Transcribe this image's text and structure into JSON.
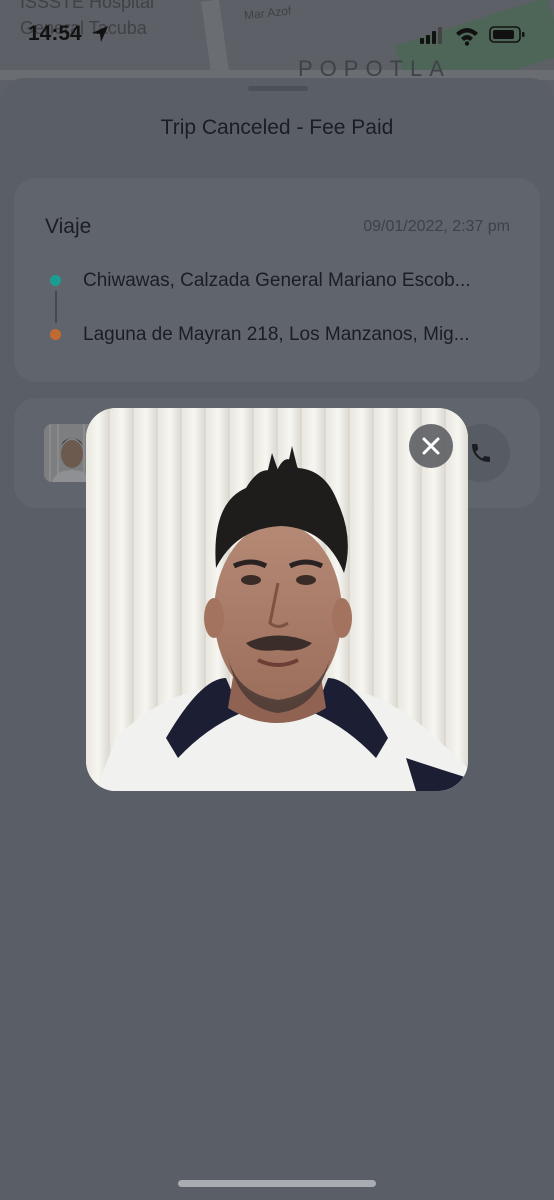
{
  "map": {
    "labels": [
      "ISSSTE Hospital",
      "General Tacuba",
      "Mar Azof",
      "POPOTLA"
    ]
  },
  "status_bar": {
    "time": "14:54",
    "icons": [
      "location-arrow-icon",
      "signal-icon",
      "wifi-icon",
      "battery-icon"
    ]
  },
  "sheet": {
    "title": "Trip Canceled - Fee Paid"
  },
  "trip": {
    "label": "Viaje",
    "datetime": "09/01/2022, 2:37 pm",
    "origin": "Chiwawas, Calzada General Mariano Escob...",
    "destination": "Laguna de Mayran 218, Los Manzanos, Mig...",
    "origin_color": "#1a9e92",
    "destination_color": "#c26a30"
  },
  "driver": {
    "avatar_icon": "driver-photo",
    "call_icon": "phone-icon"
  },
  "photo_modal": {
    "close_icon": "close-icon"
  }
}
